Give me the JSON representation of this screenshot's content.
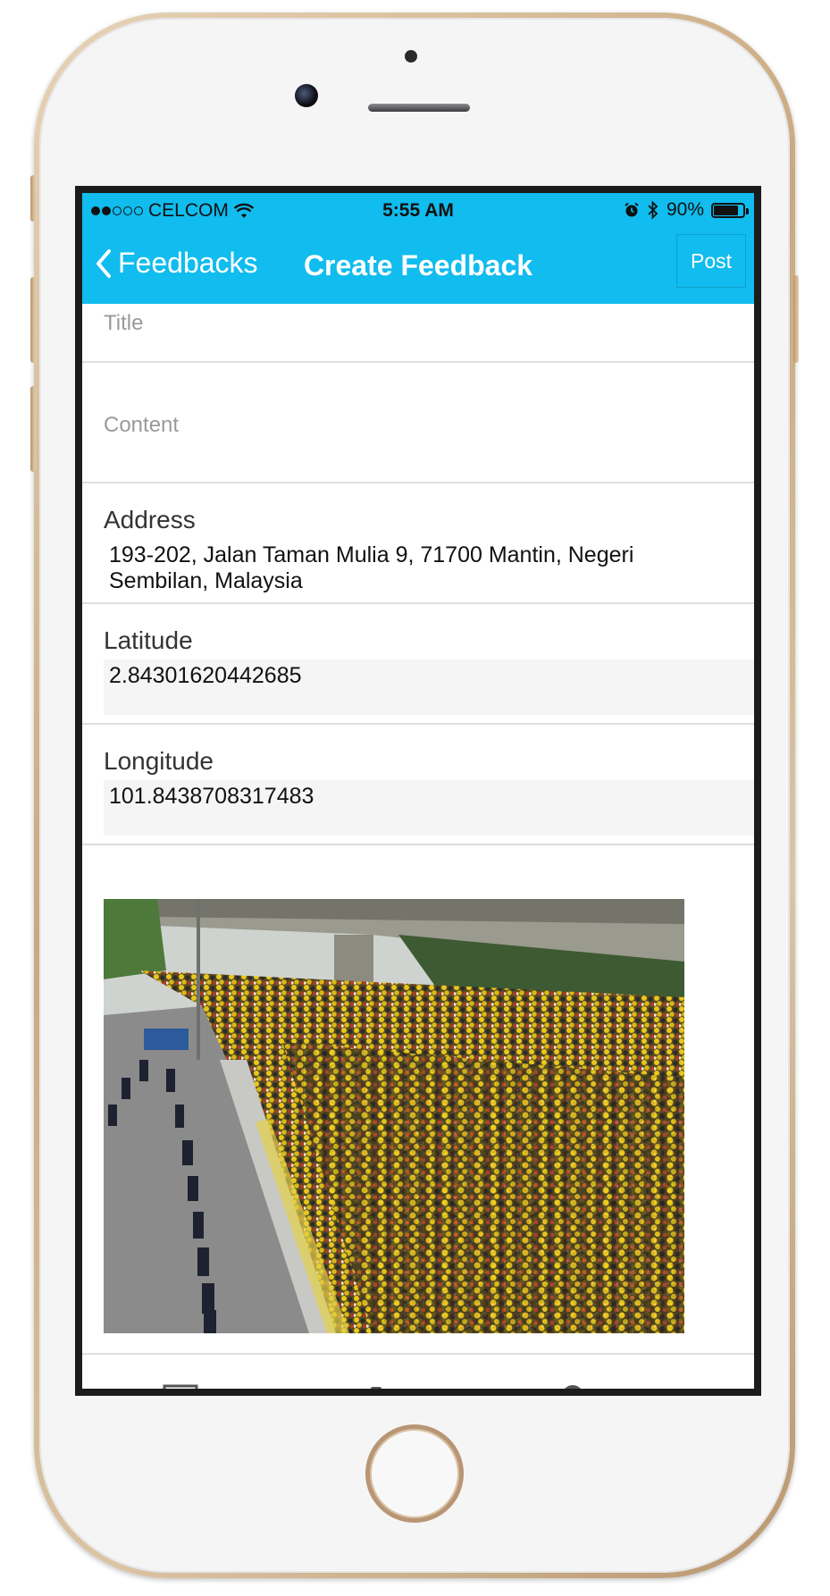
{
  "status_bar": {
    "carrier": "CELCOM",
    "signal_bars_filled": 2,
    "signal_bars_total": 5,
    "time": "5:55 AM",
    "battery_percent": "90%",
    "battery_level": 0.9
  },
  "nav": {
    "back_label": "Feedbacks",
    "title": "Create Feedback",
    "post_label": "Post"
  },
  "form": {
    "title_placeholder": "Title",
    "content_placeholder": "Content",
    "address_label": "Address",
    "address_value": "193-202, Jalan Taman Mulia 9, 71700 Mantin, Negeri Sembilan, Malaysia",
    "latitude_label": "Latitude",
    "latitude_value": "2.84301620442685",
    "longitude_label": "Longitude",
    "longitude_value": "101.8438708317483"
  },
  "toolbar": {
    "icons": [
      "image-icon",
      "camera-icon",
      "location-pin-icon"
    ]
  },
  "colors": {
    "accent": "#11bcee",
    "phone_gold": "#c9a97f"
  }
}
